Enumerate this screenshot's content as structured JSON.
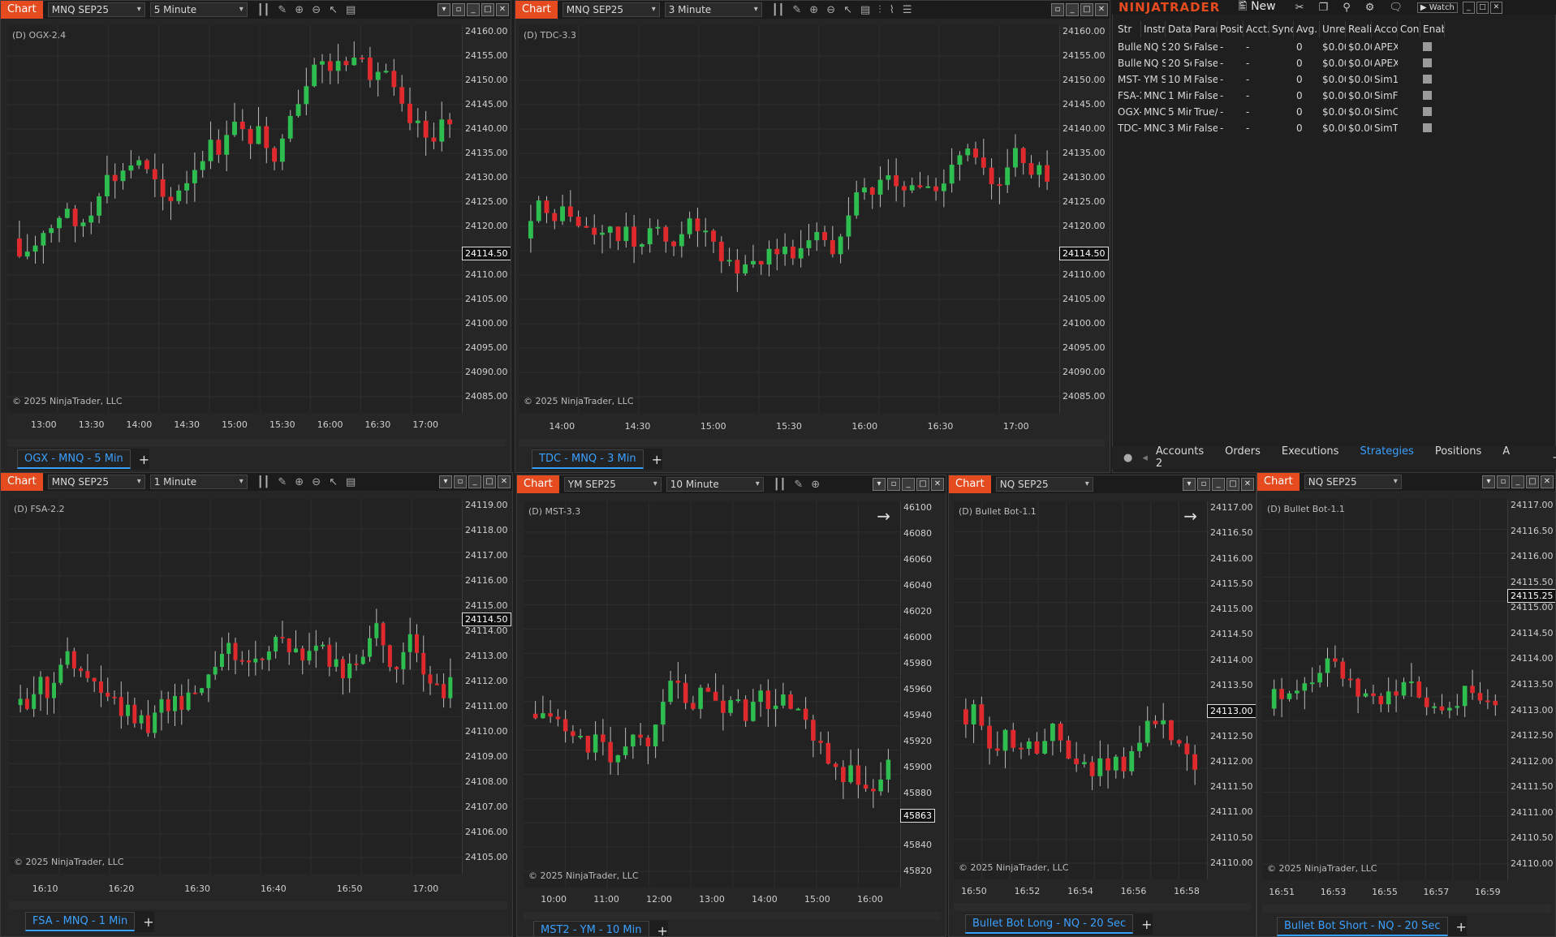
{
  "colors": {
    "up": "#2ebd4f",
    "down": "#e0292c",
    "brand": "#e64b1f",
    "accent_blue": "#3aa0ff"
  },
  "copyright": "© 2025 NinjaTrader, LLC",
  "chart_tab_label": "Chart",
  "charts": [
    {
      "id": "ogx",
      "instrument": "MNQ SEP25",
      "interval": "5 Minute",
      "label": "(D) OGX-2.4",
      "tab": "OGX - MNQ - 5 Min",
      "last_price": "24114.50",
      "y_ticks": [
        "24160.00",
        "24155.00",
        "24150.00",
        "24145.00",
        "24140.00",
        "24135.00",
        "24130.00",
        "24125.00",
        "24120.00",
        "24115.00",
        "24110.00",
        "24105.00",
        "24100.00",
        "24095.00",
        "24090.00",
        "24085.00"
      ],
      "x_ticks": [
        "13:00",
        "13:30",
        "14:00",
        "14:30",
        "15:00",
        "15:30",
        "16:00",
        "16:30",
        "17:00"
      ]
    },
    {
      "id": "tdc",
      "instrument": "MNQ SEP25",
      "interval": "3 Minute",
      "label": "(D) TDC-3.3",
      "tab": "TDC - MNQ - 3 Min",
      "last_price": "24114.50",
      "y_ticks": [
        "24160.00",
        "24155.00",
        "24150.00",
        "24145.00",
        "24140.00",
        "24135.00",
        "24130.00",
        "24125.00",
        "24120.00",
        "24115.00",
        "24110.00",
        "24105.00",
        "24100.00",
        "24095.00",
        "24090.00",
        "24085.00"
      ],
      "x_ticks": [
        "14:00",
        "14:30",
        "15:00",
        "15:30",
        "16:00",
        "16:30",
        "17:00"
      ]
    },
    {
      "id": "fsa",
      "instrument": "MNQ SEP25",
      "interval": "1 Minute",
      "label": "(D) FSA-2.2",
      "tab": "FSA - MNQ - 1 Min",
      "last_price": "24114.50",
      "y_ticks": [
        "24119.00",
        "24118.00",
        "24117.00",
        "24116.00",
        "24115.00",
        "24114.00",
        "24113.00",
        "24112.00",
        "24111.00",
        "24110.00",
        "24109.00",
        "24108.00",
        "24107.00",
        "24106.00",
        "24105.00"
      ],
      "x_ticks": [
        "16:10",
        "16:20",
        "16:30",
        "16:40",
        "16:50",
        "17:00"
      ]
    },
    {
      "id": "mst",
      "instrument": "YM SEP25",
      "interval": "10 Minute",
      "label": "(D) MST-3.3",
      "tab": "MST2 - YM - 10 Min",
      "last_price": "45863",
      "y_ticks": [
        "46100",
        "46080",
        "46060",
        "46040",
        "46020",
        "46000",
        "45980",
        "45960",
        "45940",
        "45920",
        "45900",
        "45880",
        "45860",
        "45840",
        "45820"
      ],
      "x_ticks": [
        "10:00",
        "11:00",
        "12:00",
        "13:00",
        "14:00",
        "15:00",
        "16:00"
      ]
    },
    {
      "id": "bblong",
      "instrument": "NQ SEP25",
      "interval": "",
      "label": "(D) Bullet Bot-1.1",
      "tab": "Bullet Bot Long - NQ - 20 Sec",
      "last_price": "24113.00",
      "y_ticks": [
        "24117.00",
        "24116.50",
        "24116.00",
        "24115.50",
        "24115.00",
        "24114.50",
        "24114.00",
        "24113.50",
        "24113.00",
        "24112.50",
        "24112.00",
        "24111.50",
        "24111.00",
        "24110.50",
        "24110.00"
      ],
      "x_ticks": [
        "16:50",
        "16:52",
        "16:54",
        "16:56",
        "16:58"
      ]
    },
    {
      "id": "bbshort",
      "instrument": "NQ SEP25",
      "interval": "",
      "label": "(D) Bullet Bot-1.1",
      "tab": "Bullet Bot Short - NQ - 20 Sec",
      "last_price": "24115.25",
      "y_ticks": [
        "24117.00",
        "24116.50",
        "24116.00",
        "24115.50",
        "24115.00",
        "24114.50",
        "24114.00",
        "24113.50",
        "24113.00",
        "24112.50",
        "24112.00",
        "24111.50",
        "24111.00",
        "24110.50",
        "24110.00"
      ],
      "x_ticks": [
        "16:51",
        "16:53",
        "16:55",
        "16:57",
        "16:59"
      ]
    }
  ],
  "control_center": {
    "logo": "NINJATRADER",
    "new_label": "New",
    "watch_label": "Watch",
    "columns": [
      "Str",
      "Instru",
      "Data",
      "Paran",
      "Positi",
      "Acct.",
      "Sync",
      "Avg.",
      "Unrea",
      "Realiz",
      "Acco",
      "Conn",
      "Enabl"
    ],
    "rows": [
      [
        "Bullet",
        "NQ S",
        "20 Se",
        "False,",
        "-",
        "-",
        "",
        "0",
        "$0.00",
        "$0.00",
        "APEX",
        ""
      ],
      [
        "Bullet",
        "NQ S",
        "20 Se",
        "False,",
        "-",
        "-",
        "",
        "0",
        "$0.00",
        "$0.00",
        "APEX",
        ""
      ],
      [
        "MST-",
        "YM S",
        "10 M",
        "False,",
        "-",
        "-",
        "",
        "0",
        "$0.00",
        "$0.00",
        "Sim1",
        ""
      ],
      [
        "FSA-2",
        "MNC",
        "1 Mir",
        "False,",
        "-",
        "-",
        "",
        "0",
        "$0.00",
        "$0.00",
        "SimF",
        ""
      ],
      [
        "OGX-",
        "MNC",
        "5 Mir",
        "True/,",
        "-",
        "-",
        "",
        "0",
        "$0.00",
        "$0.00",
        "SimC",
        ""
      ],
      [
        "TDC-",
        "MNC",
        "3 Mir",
        "False,",
        "-",
        "-",
        "",
        "0",
        "$0.00",
        "$0.00",
        "SimT",
        ""
      ]
    ],
    "tabs": [
      "Accounts 2",
      "Orders",
      "Executions",
      "Strategies",
      "Positions",
      "A"
    ],
    "selected_tab": "Strategies"
  }
}
